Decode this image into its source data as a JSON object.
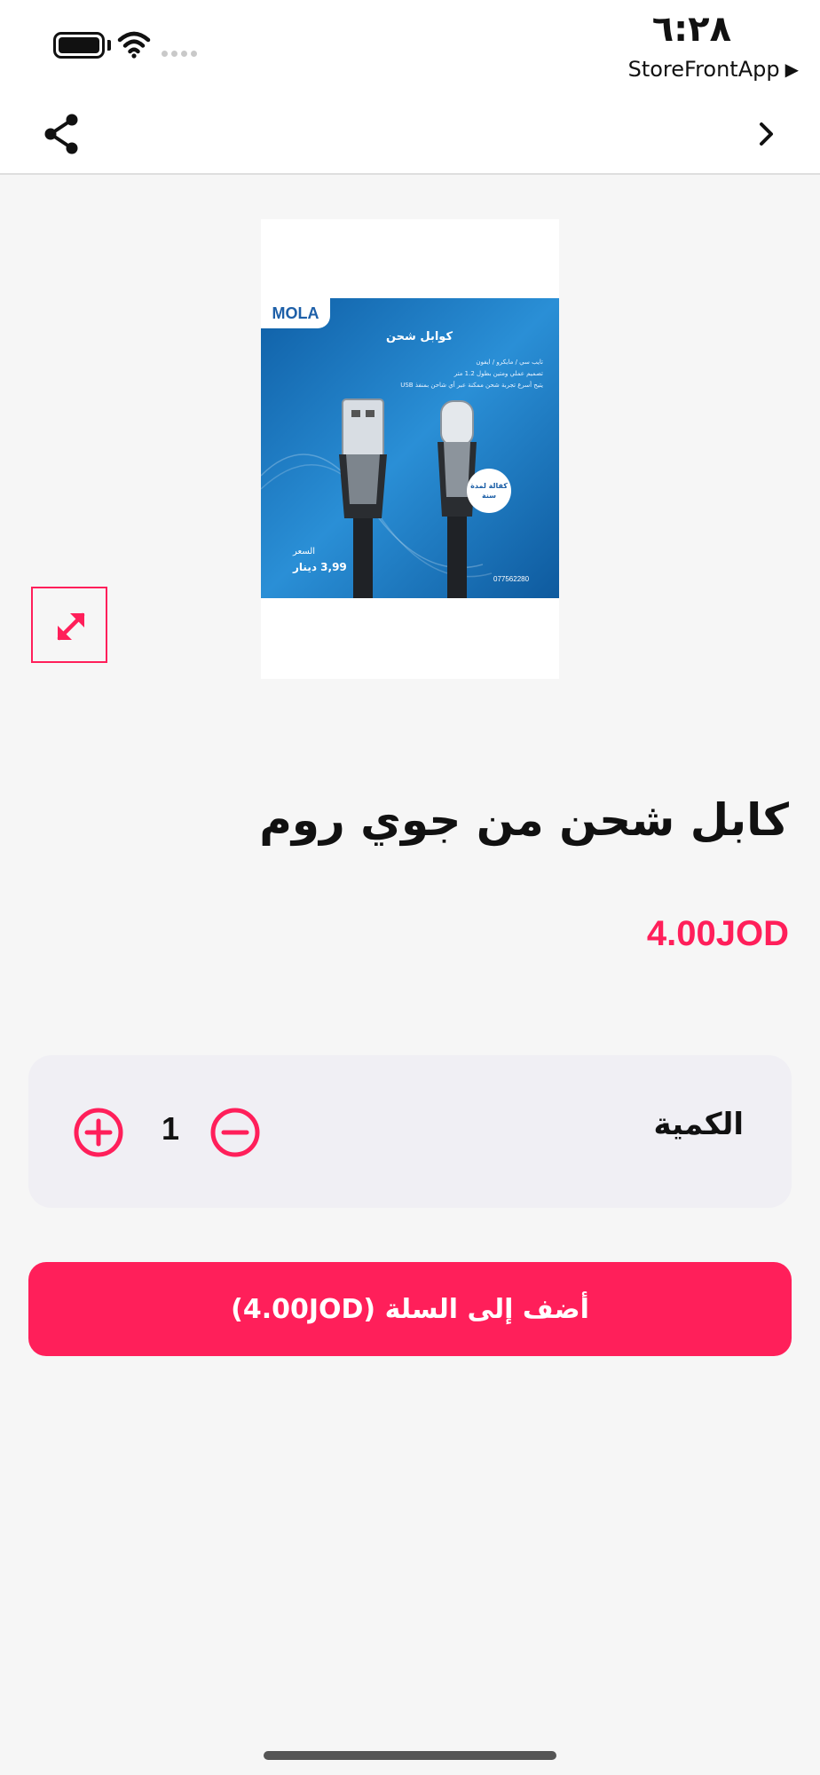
{
  "status_bar": {
    "time": "٦:٢٨",
    "app_name": "StoreFrontApp",
    "app_indicator": "▶"
  },
  "icons": {
    "share": "share-icon",
    "forward": "chevron-right-icon",
    "expand": "expand-icon",
    "plus": "plus-circle-icon",
    "minus": "minus-circle-icon"
  },
  "colors": {
    "accent": "#ff1f5a",
    "background": "#f6f6f6",
    "panel": "#f0eff4"
  },
  "product": {
    "image": {
      "logo": "MOLA",
      "headline": "كوابل شحن",
      "bullets": [
        "تايب سي / مايكرو / ايفون",
        "تصميم عملي ومتين بطول 1.2 متر",
        "يتيح أسرع تجربة شحن ممكنة عبر أي شاحن بمنفذ USB"
      ],
      "badge": "كفالة لمدة سنة",
      "price_label": "السعر",
      "price": "3,99 دينار",
      "phone": "077562280"
    },
    "title": "كابل شحن من جوي روم",
    "price": "4.00JOD"
  },
  "quantity": {
    "label": "الكمية",
    "value": "1"
  },
  "cart": {
    "button_label": "أضف إلى السلة (4.00JOD)"
  }
}
